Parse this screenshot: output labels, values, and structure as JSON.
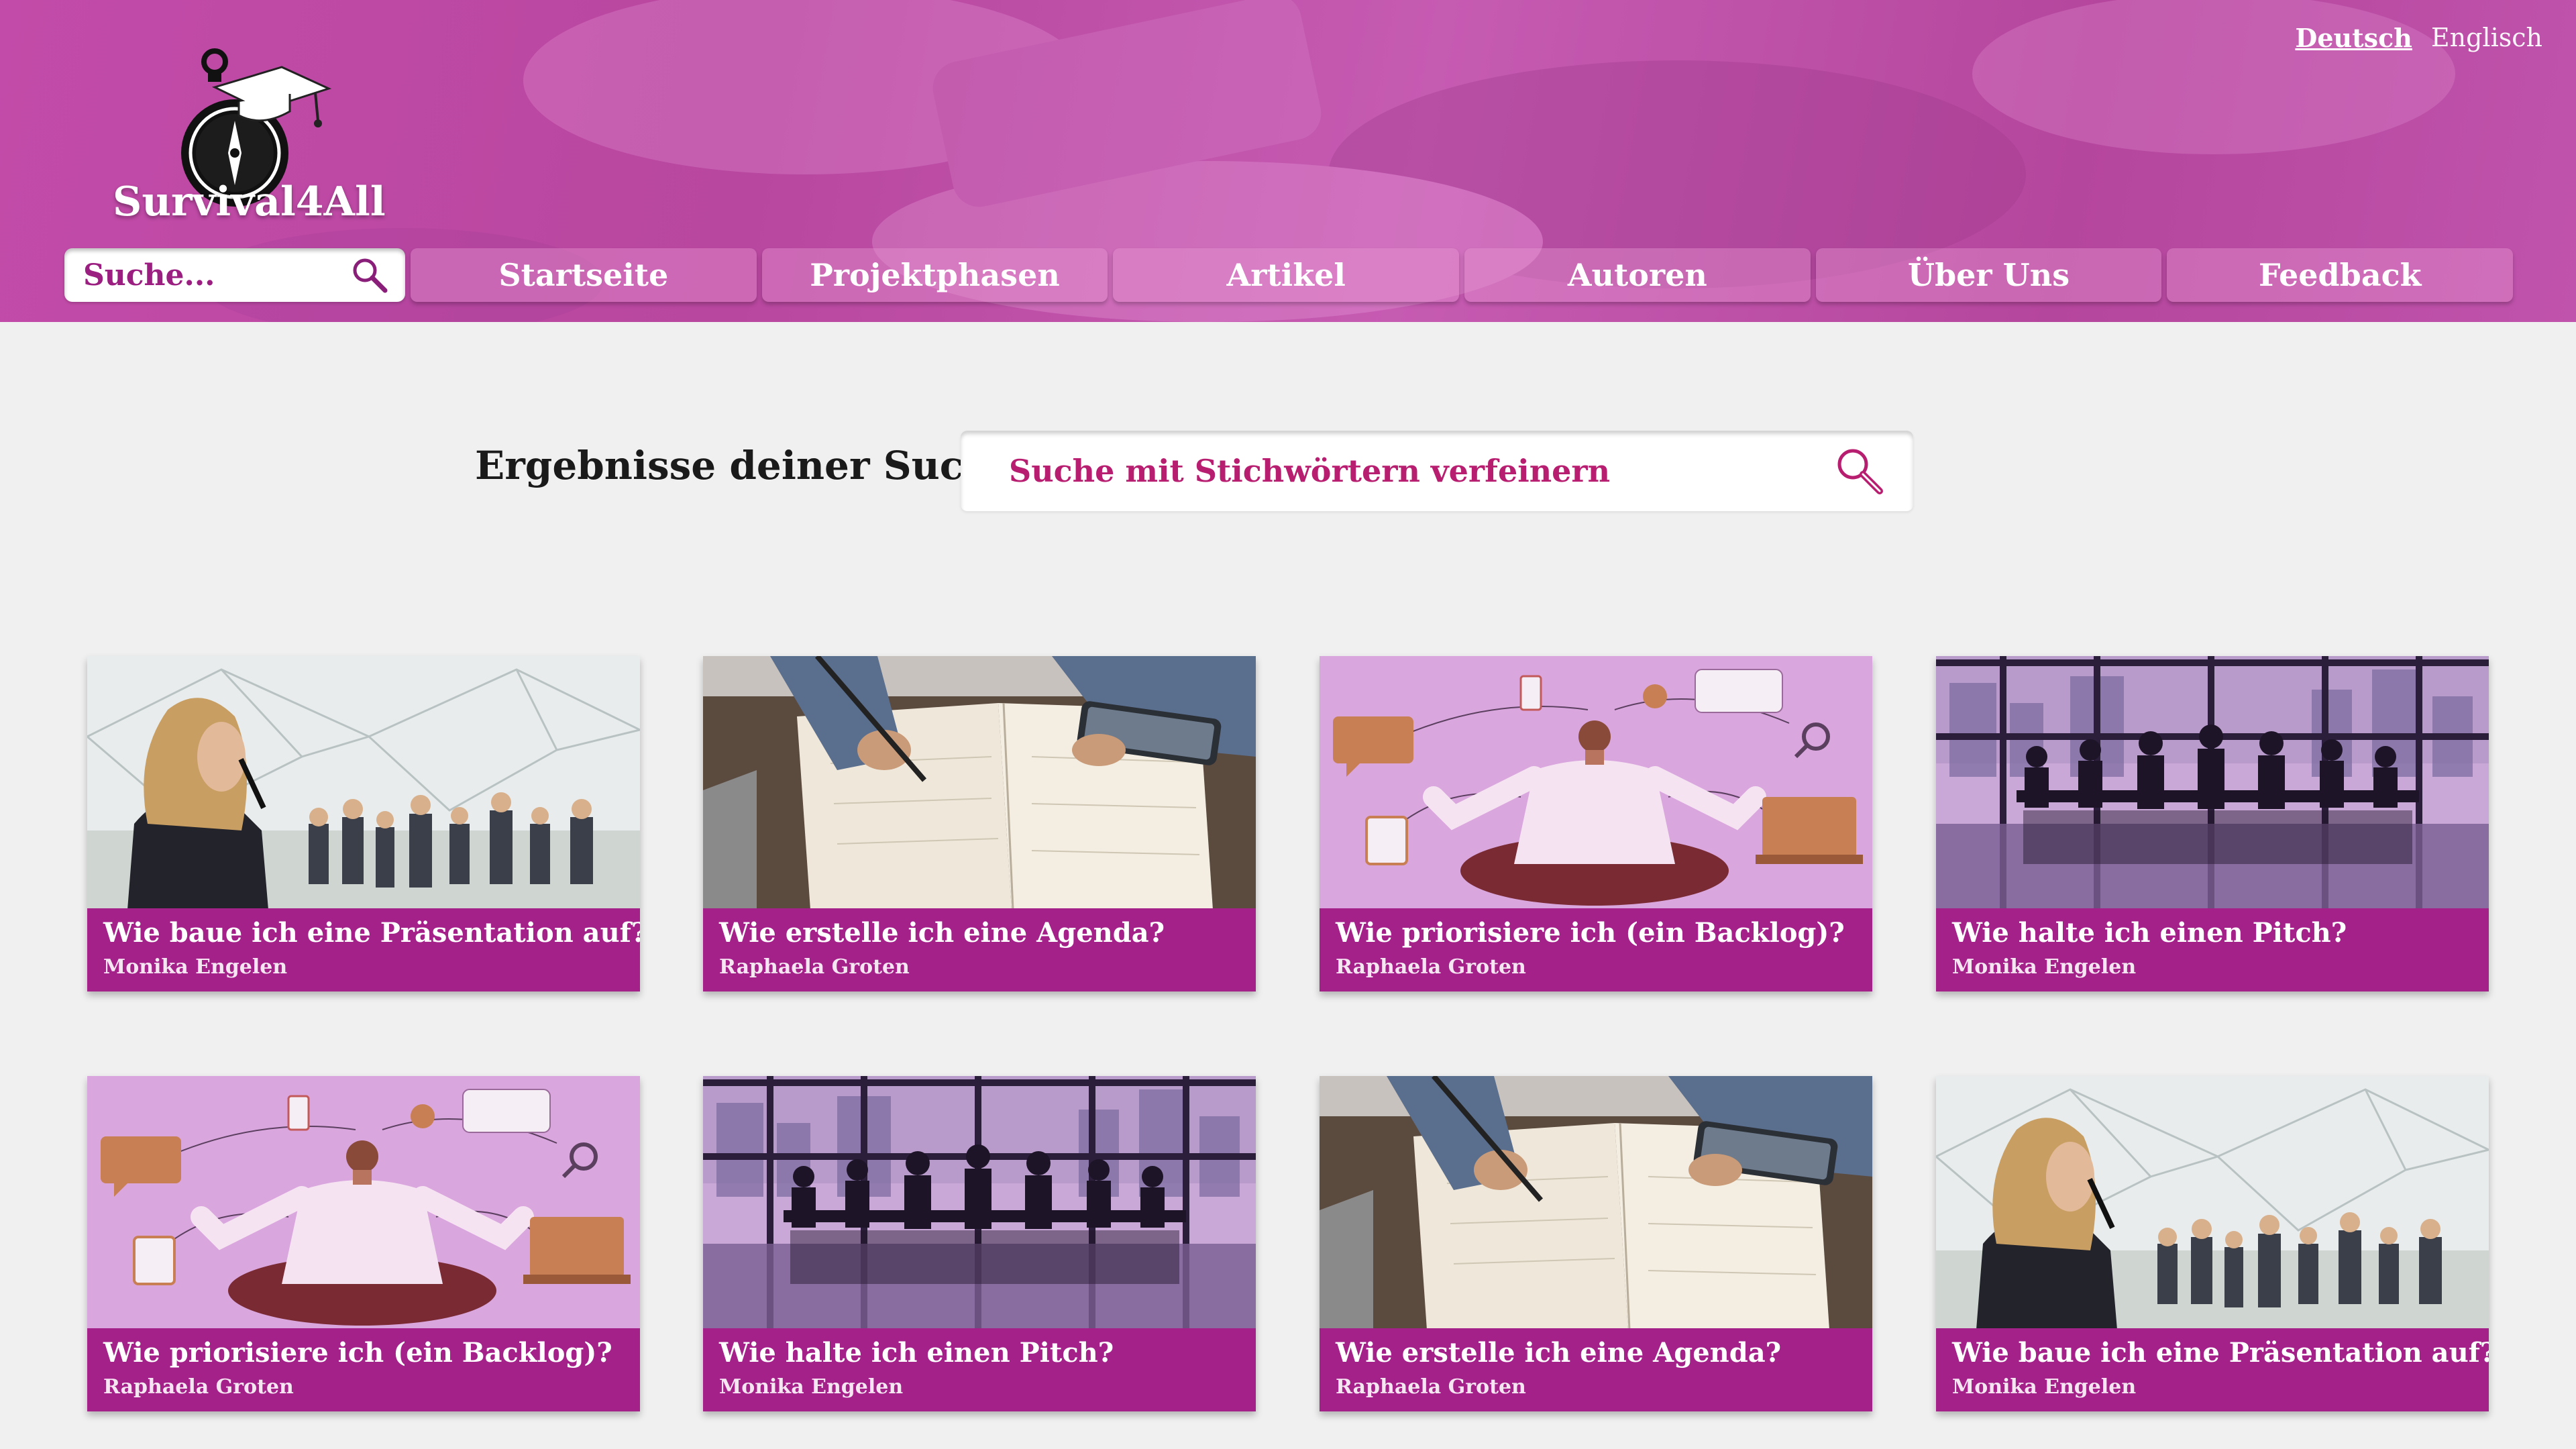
{
  "header": {
    "languages": {
      "active": "Deutsch",
      "other": "Englisch"
    },
    "logo_title": "Survival4All",
    "search_placeholder": "Suche...",
    "nav": [
      "Startseite",
      "Projektphasen",
      "Artikel",
      "Autoren",
      "Über Uns",
      "Feedback"
    ]
  },
  "results": {
    "title": "Ergebnisse deiner Suche",
    "refine_placeholder": "Suche mit Stichwörtern verfeinern"
  },
  "cards": [
    {
      "title": "Wie baue ich eine Präsentation auf?",
      "author": "Monika Engelen",
      "image": "presentation"
    },
    {
      "title": "Wie erstelle ich eine Agenda?",
      "author": "Raphaela Groten",
      "image": "agenda"
    },
    {
      "title": "Wie priorisiere ich (ein Backlog)?",
      "author": "Raphaela Groten",
      "image": "backlog"
    },
    {
      "title": "Wie halte ich einen Pitch?",
      "author": "Monika Engelen",
      "image": "pitch"
    },
    {
      "title": "Wie priorisiere ich (ein Backlog)?",
      "author": "Raphaela Groten",
      "image": "backlog"
    },
    {
      "title": "Wie halte ich einen Pitch?",
      "author": "Monika Engelen",
      "image": "pitch"
    },
    {
      "title": "Wie erstelle ich eine Agenda?",
      "author": "Raphaela Groten",
      "image": "agenda"
    },
    {
      "title": "Wie baue ich eine Präsentation auf?",
      "author": "Monika Engelen",
      "image": "presentation"
    }
  ],
  "colors": {
    "header_magenta": "#c24ba9",
    "caption_purple": "#a4218a",
    "accent_pink": "#b81e70",
    "page_bg": "#f0f0f0"
  }
}
